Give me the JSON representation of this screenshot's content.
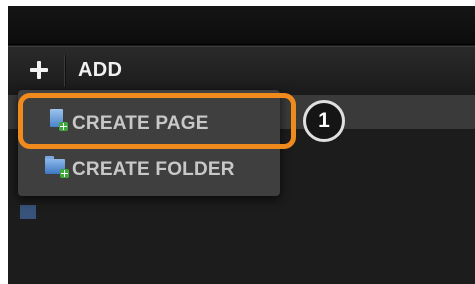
{
  "toolbar": {
    "add_label": "ADD",
    "add_icon": "plus-icon"
  },
  "menu": {
    "items": [
      {
        "label": "CREATE PAGE",
        "icon": "document-add-icon"
      },
      {
        "label": "CREATE FOLDER",
        "icon": "folder-add-icon"
      }
    ]
  },
  "callout": {
    "number": "1"
  },
  "colors": {
    "highlight": "#f08a1c",
    "menu_background": "#3f3f3f",
    "toolbar_background": "#1a1a1a",
    "icon_blue": "#4a84cc",
    "icon_plus_green": "#3ea83a"
  }
}
